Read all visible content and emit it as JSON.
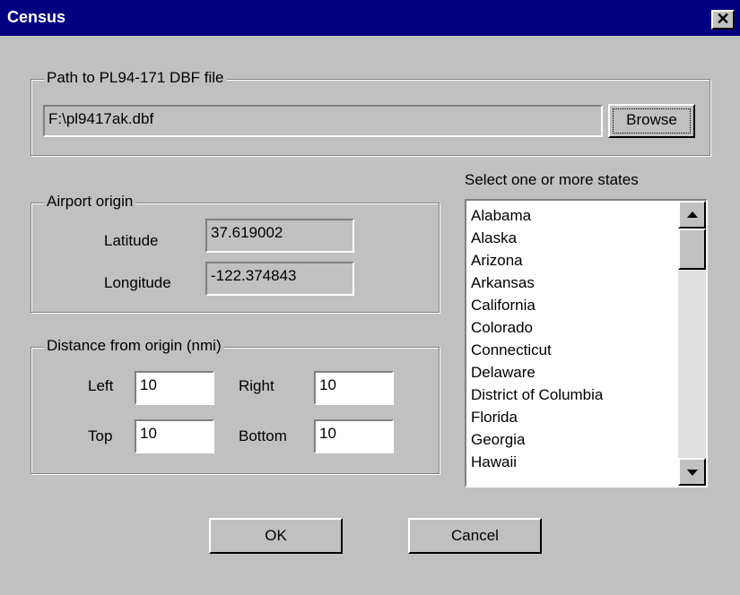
{
  "window": {
    "title": "Census",
    "close_glyph": "✕"
  },
  "path_group": {
    "legend": "Path to PL94-171 DBF file",
    "path_value": "F:\\pl9417ak.dbf",
    "browse_label": "Browse"
  },
  "airport_group": {
    "legend": "Airport origin",
    "latitude_label": "Latitude",
    "latitude_value": "37.619002",
    "longitude_label": "Longitude",
    "longitude_value": "-122.374843"
  },
  "distance_group": {
    "legend": "Distance from origin (nmi)",
    "left_label": "Left",
    "left_value": "10",
    "right_label": "Right",
    "right_value": "10",
    "top_label": "Top",
    "top_value": "10",
    "bottom_label": "Bottom",
    "bottom_value": "10"
  },
  "states": {
    "label": "Select one or more states",
    "items": [
      "Alabama",
      "Alaska",
      "Arizona",
      "Arkansas",
      "California",
      "Colorado",
      "Connecticut",
      "Delaware",
      "District of Columbia",
      "Florida",
      "Georgia",
      "Hawaii"
    ]
  },
  "buttons": {
    "ok": "OK",
    "cancel": "Cancel"
  },
  "colors": {
    "titlebar": "#000080",
    "face": "#c0c0c0",
    "field": "#ffffff"
  }
}
